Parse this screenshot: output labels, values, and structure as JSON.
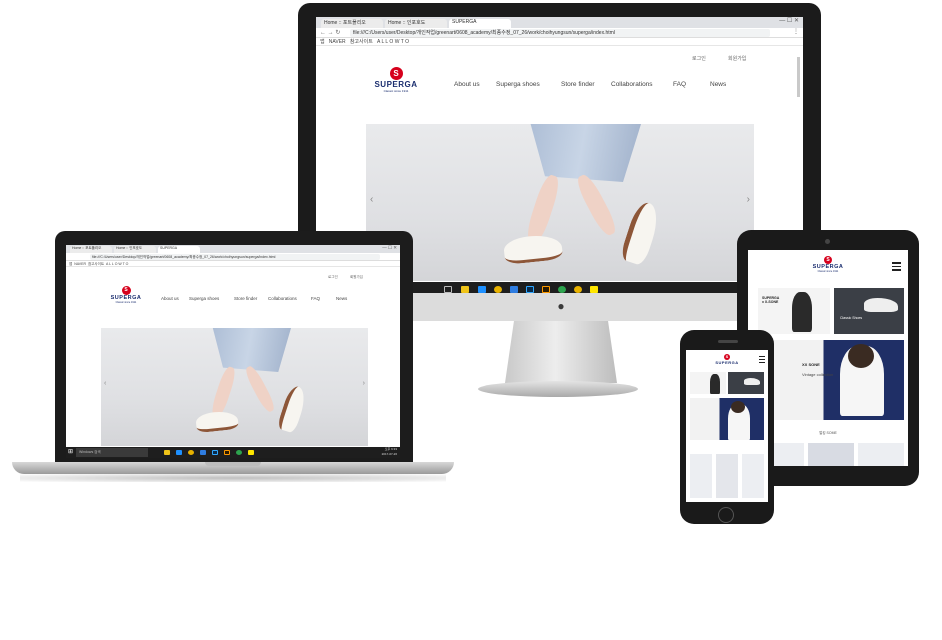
{
  "browser": {
    "tabs": [
      {
        "label": "Home :: 포트폴리오"
      },
      {
        "label": "Home :: 인포호도"
      },
      {
        "label": "SUPERGA"
      }
    ],
    "url": "file:///C:/Users/user/Desktop/개인작업/greenart/0608_academy/최종수정_07_26/work/choihyungsun/superga/index.html",
    "bookmarks": [
      "앱",
      "NAVER",
      "참고사이트",
      "A L L O W T O"
    ]
  },
  "site": {
    "brand": {
      "name": "SUPERGA",
      "tagline": "Classic since 1911",
      "mark": "S"
    },
    "util_links": [
      "로그인",
      "회원가입"
    ],
    "nav": [
      "About us",
      "Superga shoes",
      "Store finder",
      "Collaborations",
      "FAQ",
      "News"
    ],
    "hero_arrows": {
      "prev": "‹",
      "next": "›"
    }
  },
  "taskbar": {
    "search_placeholder": "Windows 검색",
    "clock": "오후 9:33",
    "date": "2017-07-26"
  },
  "mobile": {
    "tiles": [
      {
        "title": "SUPERGA x X-SONE"
      },
      {
        "title": "Classic Shoes"
      },
      {
        "title": "XX SONE",
        "subtitle": "Vintage collection"
      }
    ],
    "section_label": "얼킹 SOME"
  },
  "colors": {
    "brand_red": "#d6001c",
    "brand_navy": "#1a2d6e"
  }
}
